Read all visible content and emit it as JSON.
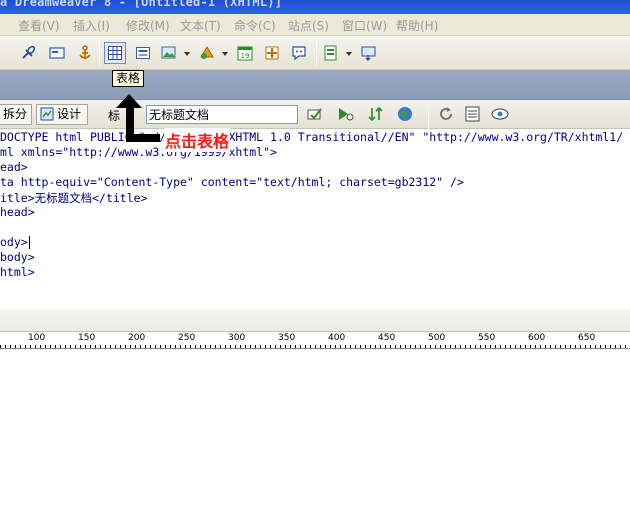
{
  "window": {
    "title": "a Dreamweaver 8 - [Untitled-1 (XHTML)]"
  },
  "menu": {
    "items": [
      "查看(V)",
      "插入(I)",
      "修改(M)",
      "文本(T)",
      "命令(C)",
      "站点(S)",
      "窗口(W)",
      "帮助(H)"
    ]
  },
  "insert_toolbar": {
    "icons": [
      "hyperlink-icon",
      "email-link-icon",
      "named-anchor-icon",
      "table-icon",
      "div-icon",
      "image-icon",
      "media-icon",
      "date-icon",
      "server-side-include-icon",
      "comment-icon",
      "template-icon",
      "tag-chooser-icon"
    ]
  },
  "tooltip": {
    "text": "表格"
  },
  "document_toolbar": {
    "split_label": "拆分",
    "design_label": "设计",
    "title_label": "标",
    "title_value": "无标题文档"
  },
  "code": {
    "lines": [
      "DOCTYPE html PUBLIC \"-//W3C//DTD XHTML 1.0 Transitional//EN\" \"http://www.w3.org/TR/xhtml1/",
      "ml xmlns=\"http://www.w3.org/1999/xhtml\">",
      "ead>",
      "ta http-equiv=\"Content-Type\" content=\"text/html; charset=gb2312\" />",
      "itle>无标题文档</title>",
      "head>",
      "",
      "ody>",
      "body>",
      "html>"
    ]
  },
  "annotation": {
    "text": "点击表格",
    "color": "#ff1a1a"
  },
  "ruler": {
    "labels": [
      "100",
      "150",
      "200",
      "250",
      "300",
      "350",
      "400",
      "450",
      "500",
      "550",
      "600",
      "650"
    ]
  }
}
